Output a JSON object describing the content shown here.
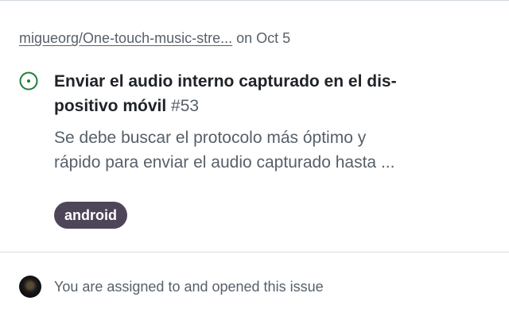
{
  "header": {
    "repo": "miguеorg/One-touch-music-stre...",
    "date_text": "on Oct 5"
  },
  "issue": {
    "state_icon": "issue-opened-icon",
    "title": "Enviar el audio interno capturado en el dis-positivo móvil",
    "title_line1": "Enviar el audio interno capturado en el dis-",
    "title_line2": "positivo móvil",
    "number": "#53",
    "body_line1": "Se debe buscar el protocolo más óptimo y",
    "body_line2": "rápido para enviar el audio capturado hasta ...",
    "label": "android"
  },
  "footer": {
    "text": "You are assigned to and opened this issue"
  },
  "colors": {
    "open_icon": "#1a7f37",
    "label_bg": "#4f4558",
    "muted_text": "#57606a"
  }
}
